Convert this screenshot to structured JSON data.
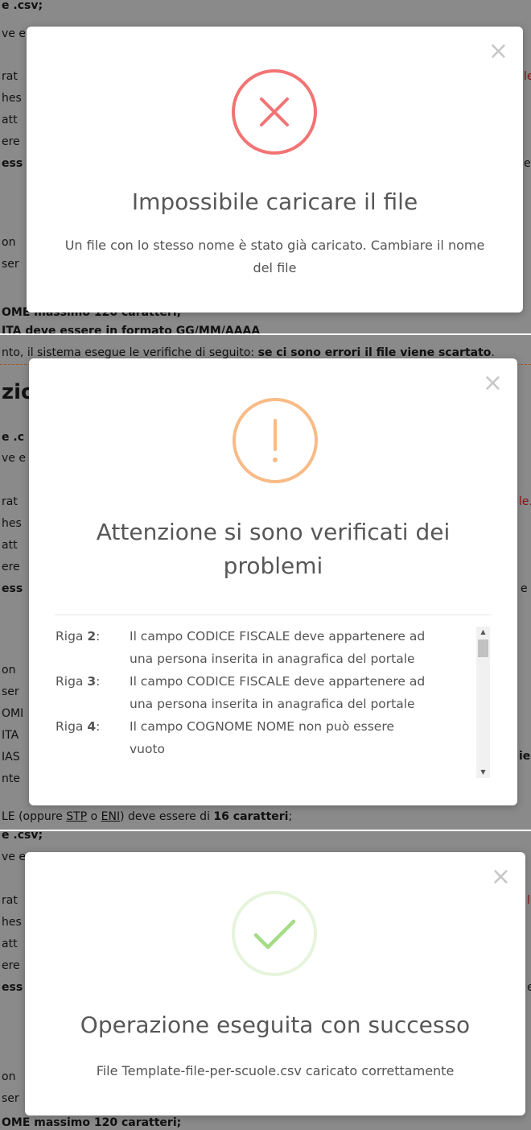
{
  "panel1": {
    "background_lines": [
      "e .csv;",
      "ve e",
      "rat",
      "hes",
      "att",
      "ere",
      "ess",
      "on",
      "ser",
      "OME massimo 120 caratteri;",
      "ITA deve essere in formato GG/MM/AAAA"
    ],
    "right_fragments": [
      "le",
      "e"
    ],
    "modal": {
      "title": "Impossibile caricare il file",
      "message": "Un file con lo stesso nome è stato già caricato. Cambiare il nome del file",
      "close": "×",
      "icon": "error-x-icon",
      "icon_color": "#f27474"
    }
  },
  "panel2": {
    "top_line_prefix": "nto, il sistema esegue le verifiche di seguito: ",
    "top_line_bold": "se ci sono errori il file viene scartato",
    "top_line_suffix": ".",
    "heading_fragment": "zio",
    "background_lines": [
      "e .c",
      "ve e",
      "rat",
      "hes",
      "att",
      "ere",
      "ess",
      "on",
      "ser",
      "OMI",
      "ITA",
      "IAS",
      "nte"
    ],
    "right_fragments": [
      "le.",
      "e",
      "ie:"
    ],
    "bottom_line_prefix": "LE (oppure ",
    "bottom_line_stp": "STP",
    "bottom_line_o": " o ",
    "bottom_line_eni": "ENI",
    "bottom_line_mid": ") deve essere di ",
    "bottom_line_bold": "16 caratteri",
    "bottom_line_suffix": ";",
    "modal": {
      "title_line1": "Attenzione si sono verificati dei",
      "title_line2": "problemi",
      "close": "×",
      "icon": "warning-exclamation-icon",
      "icon_color": "#f8bb86",
      "errors": [
        {
          "prefix": "Riga ",
          "num": "2",
          "suffix": ":",
          "line1": "Il campo CODICE FISCALE deve appartenere ad",
          "line2": "una persona inserita in anagrafica del portale"
        },
        {
          "prefix": "Riga ",
          "num": "3",
          "suffix": ":",
          "line1": "Il campo CODICE FISCALE deve appartenere ad",
          "line2": "una persona inserita in anagrafica del portale"
        },
        {
          "prefix": "Riga ",
          "num": "4",
          "suffix": ":",
          "line1": "Il campo COGNOME NOME non può essere",
          "line2": "vuoto"
        }
      ]
    }
  },
  "panel3": {
    "background_lines": [
      "e .csv;",
      "ve e",
      "rat",
      "hes",
      "att",
      "ere",
      "ess",
      "on",
      "ser",
      "OME massimo 120 caratteri;"
    ],
    "right_fragments": [
      "l",
      "e"
    ],
    "modal": {
      "title": "Operazione eseguita con successo",
      "message": "File Template-file-per-scuole.csv caricato correttamente",
      "close": "×",
      "icon": "success-check-icon",
      "icon_color": "#a5dc86"
    }
  }
}
